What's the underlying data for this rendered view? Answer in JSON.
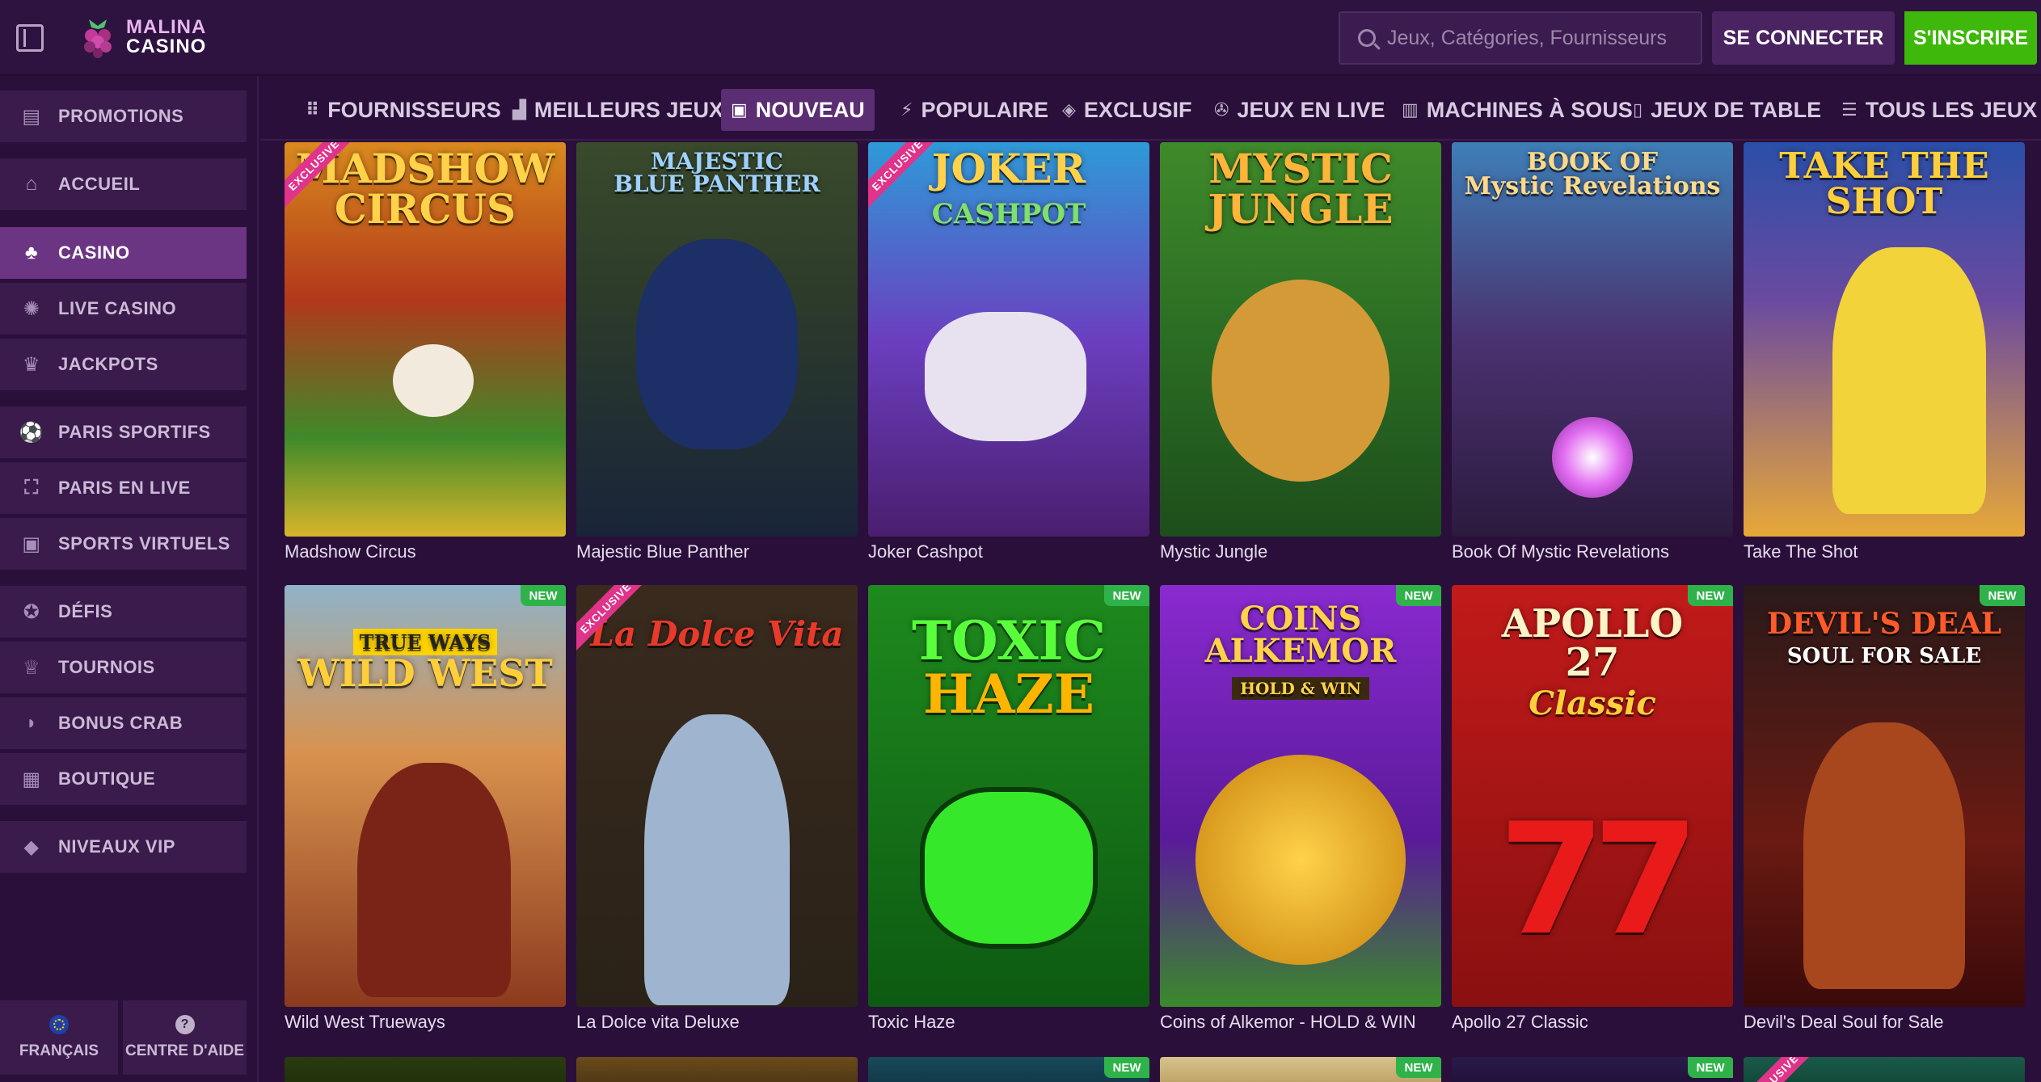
{
  "header": {
    "logo_line1": "MALINA",
    "logo_line2": "CASINO",
    "search_placeholder": "Jeux, Catégories, Fournisseurs",
    "login_label": "SE CONNECTER",
    "signup_label": "S'INSCRIRE"
  },
  "sidebar": {
    "items": [
      {
        "label": "PROMOTIONS",
        "icon": "gift-icon",
        "active": false
      },
      {
        "label": "ACCUEIL",
        "icon": "home-icon",
        "active": false
      },
      {
        "label": "CASINO",
        "icon": "casino-icon",
        "active": true
      },
      {
        "label": "LIVE CASINO",
        "icon": "roulette-icon",
        "active": false
      },
      {
        "label": "JACKPOTS",
        "icon": "crown-pot-icon",
        "active": false
      },
      {
        "label": "PARIS SPORTIFS",
        "icon": "football-icon",
        "active": false
      },
      {
        "label": "PARIS EN LIVE",
        "icon": "live-bet-icon",
        "active": false
      },
      {
        "label": "SPORTS VIRTUELS",
        "icon": "virtual-sports-icon",
        "active": false
      },
      {
        "label": "DÉFIS",
        "icon": "challenge-icon",
        "active": false
      },
      {
        "label": "TOURNOIS",
        "icon": "trophy-icon",
        "active": false
      },
      {
        "label": "BONUS CRAB",
        "icon": "crab-icon",
        "active": false
      },
      {
        "label": "BOUTIQUE",
        "icon": "shop-icon",
        "active": false
      },
      {
        "label": "NIVEAUX VIP",
        "icon": "diamond-icon",
        "active": false
      }
    ],
    "footer": {
      "language_label": "FRANÇAIS",
      "help_label": "CENTRE D'AIDE"
    }
  },
  "categories": [
    {
      "label": "FOURNISSEURS",
      "icon": "grid-icon",
      "active": false
    },
    {
      "label": "MEILLEURS JEUX",
      "icon": "podium-icon",
      "active": false
    },
    {
      "label": "NOUVEAU",
      "icon": "new-icon",
      "active": true
    },
    {
      "label": "POPULAIRE",
      "icon": "bolt-icon",
      "active": false
    },
    {
      "label": "EXCLUSIF",
      "icon": "diamond-icon",
      "active": false
    },
    {
      "label": "JEUX EN LIVE",
      "icon": "chip-icon",
      "active": false
    },
    {
      "label": "MACHINES À SOUS",
      "icon": "slot-machine-icon",
      "active": false
    },
    {
      "label": "JEUX DE TABLE",
      "icon": "cards-icon",
      "active": false
    },
    {
      "label": "TOUS LES JEUX",
      "icon": "list-icon",
      "active": false
    }
  ],
  "games_row1": [
    {
      "name": "Madshow Circus",
      "art": "MADSHOW CIRCUS",
      "badge": "EXCLUSIVE"
    },
    {
      "name": "Majestic Blue Panther",
      "art": "MAJESTIC BLUE PANTHER",
      "badge": ""
    },
    {
      "name": "Joker Cashpot",
      "art": "JOKER CASHPOT",
      "badge": "EXCLUSIVE"
    },
    {
      "name": "Mystic Jungle",
      "art": "MYSTIC JUNGLE",
      "badge": ""
    },
    {
      "name": "Book Of Mystic Revelations",
      "art": "BOOK OF Mystic Revelations",
      "badge": ""
    },
    {
      "name": "Take The Shot",
      "art": "TAKE THE SHOT",
      "badge": ""
    }
  ],
  "games_row2": [
    {
      "name": "Wild West Trueways",
      "art": "TRUE WAYS WILD WEST",
      "badge": "NEW"
    },
    {
      "name": "La Dolce vita Deluxe",
      "art": "La Dolce Vita Deluxe",
      "badge": "EXCLUSIVE"
    },
    {
      "name": "Toxic Haze",
      "art": "TOXIC HAZE",
      "badge": "NEW"
    },
    {
      "name": "Coins of Alkemor - HOLD & WIN",
      "art": "COINS OF ALKEMOR HOLD & WIN",
      "badge": "NEW"
    },
    {
      "name": "Apollo 27 Classic",
      "art": "APOLLO 27 Classic",
      "badge": "NEW"
    },
    {
      "name": "Devil's Deal Soul for Sale",
      "art": "DEVIL'S DEAL SOUL FOR SALE",
      "badge": "NEW"
    }
  ],
  "games_row3": [
    {
      "badge": ""
    },
    {
      "badge": ""
    },
    {
      "badge": "NEW"
    },
    {
      "badge": "NEW"
    },
    {
      "badge": "NEW"
    },
    {
      "badge": "EXCLUSIVE"
    }
  ],
  "colors": {
    "background": "#2a0f3a",
    "sidebar_active": "#6b3584",
    "signup_green": "#3eb80a",
    "badge_new": "#2fb24a",
    "badge_exclusive": "#e0338a"
  }
}
